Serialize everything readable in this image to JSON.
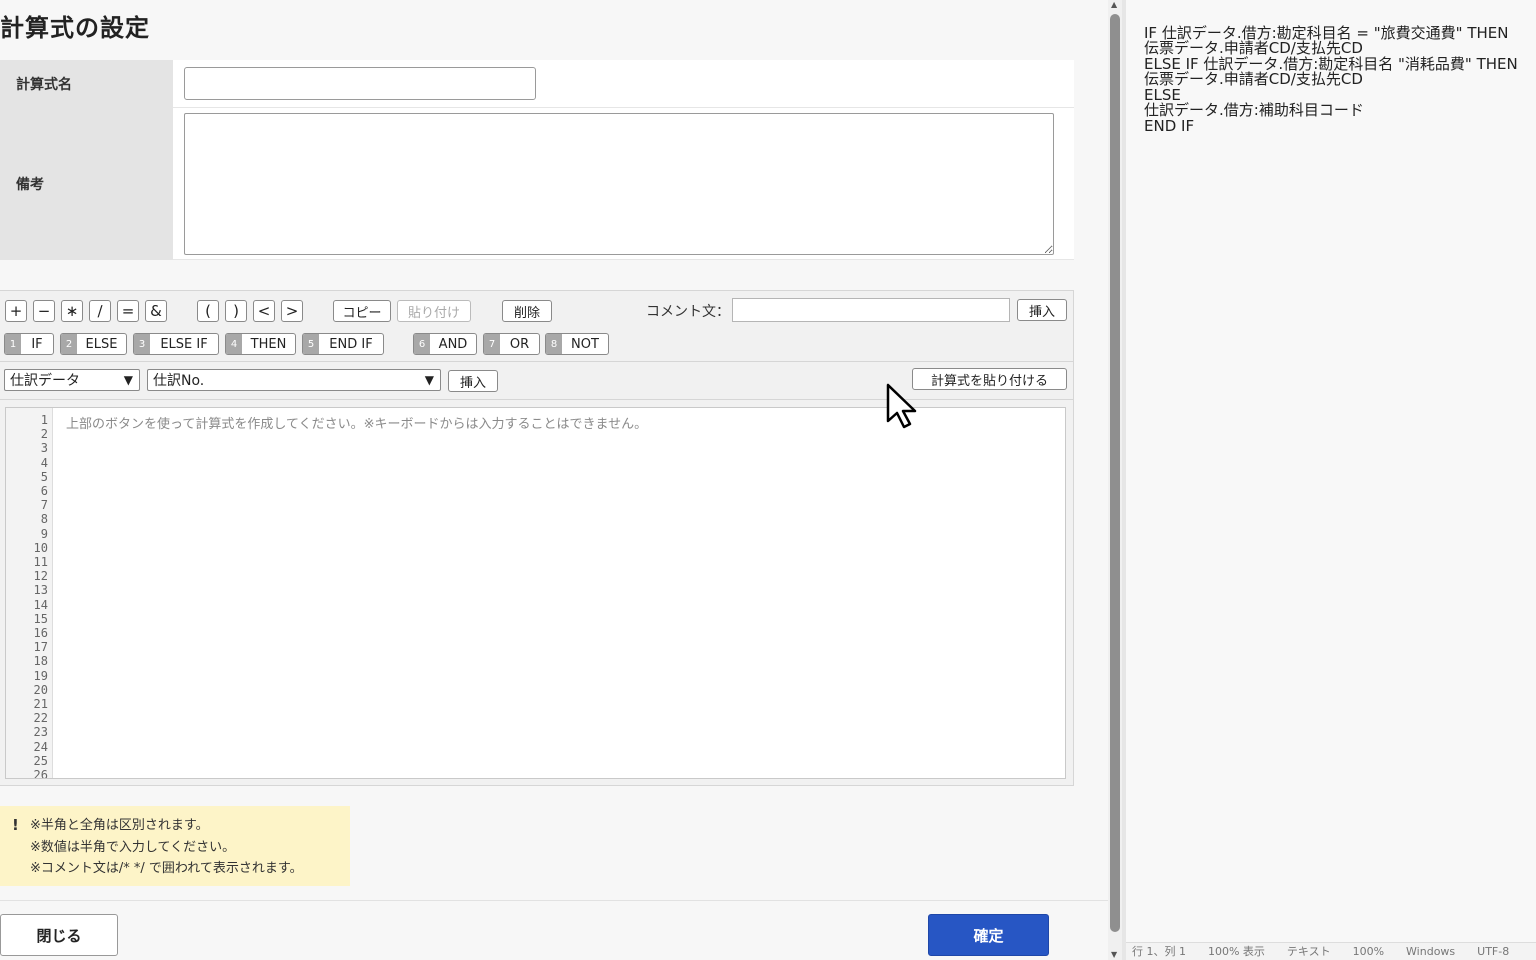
{
  "dialog": {
    "title": "計算式の設定",
    "name_label": "計算式名",
    "name_value": "",
    "memo_label": "備考",
    "memo_value": ""
  },
  "toolbar": {
    "ops": [
      "+",
      "−",
      "∗",
      "∕",
      "=",
      "&"
    ],
    "brackets": [
      "(",
      ")",
      "<",
      ">"
    ],
    "copy_label": "コピー",
    "paste_label": "貼り付け",
    "delete_label": "削除",
    "comment_label": "コメント文：",
    "comment_value": "",
    "comment_insert_label": "挿入",
    "keywords": [
      {
        "num": "1",
        "label": "IF"
      },
      {
        "num": "2",
        "label": "ELSE"
      },
      {
        "num": "3",
        "label": "ELSE IF"
      },
      {
        "num": "4",
        "label": "THEN"
      },
      {
        "num": "5",
        "label": "END IF"
      },
      {
        "num": "6",
        "label": "AND"
      },
      {
        "num": "7",
        "label": "OR"
      },
      {
        "num": "8",
        "label": "NOT"
      }
    ],
    "source_select": "仕訳データ",
    "field_select": "仕訳No.",
    "field_insert_label": "挿入",
    "paste_formula_label": "計算式を貼り付ける"
  },
  "editor": {
    "placeholder": "上部のボタンを使って計算式を作成してください。※キーボードからは入力することはできません。",
    "line_numbers": [
      "1",
      "2",
      "3",
      "4",
      "5",
      "6",
      "7",
      "8",
      "9",
      "10",
      "11",
      "12",
      "13",
      "14",
      "15",
      "16",
      "17",
      "18",
      "19",
      "20",
      "21",
      "22",
      "23",
      "24",
      "25",
      "26"
    ]
  },
  "notes": {
    "mark": "!",
    "lines": [
      "※半角と全角は区別されます。",
      "※数値は半角で入力してください。",
      "※コメント文は/* */ で囲われて表示されます。"
    ]
  },
  "footer": {
    "close_label": "閉じる",
    "confirm_label": "確定"
  },
  "right_panel": {
    "code_lines": [
      "IF 仕訳データ.借方:勘定科目名 = \"旅費交通費\" THEN",
      "    伝票データ.申請者CD/支払先CD",
      "ELSE IF 仕訳データ.借方:勘定科目名 \"消耗品費\" THEN",
      "    伝票データ.申請者CD/支払先CD",
      "ELSE",
      "    仕訳データ.借方:補助科目コード",
      "END IF"
    ],
    "status_text": "行 1、列 1　　100% 表示　　テキスト　　100%　　Windows　　UTF-8"
  },
  "colors": {
    "confirm_bg": "#2756c4",
    "note_bg": "#fdf4c8",
    "label_bg": "#e4e4e4"
  }
}
